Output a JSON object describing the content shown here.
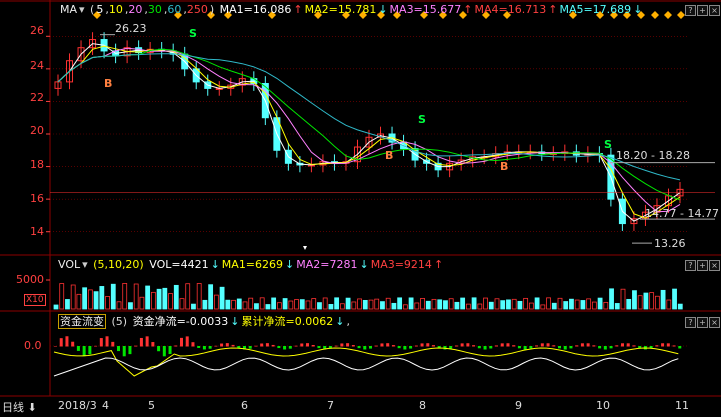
{
  "main_legend": {
    "indicator": "MA",
    "params_open": "(",
    "params": [
      "5",
      "10",
      "20",
      "30",
      "60",
      "250"
    ],
    "params_close": ")",
    "ma1": "MA1=16.086",
    "ma2": "MA2=15.781",
    "ma3": "MA3=15.677",
    "ma4": "MA4=16.713",
    "ma5": "MA5=17.689"
  },
  "vol_legend": {
    "indicator": "VOL",
    "params": "(5,10,20)",
    "vol": "VOL=4421",
    "ma1": "MA1=6269",
    "ma2": "MA2=7281",
    "ma3": "MA3=9214"
  },
  "flow_legend": {
    "indicator": "资金流变",
    "param": "(5)",
    "net": "资金净流=-0.0033",
    "cumulative": "累计净流=0.0062",
    "tail": ","
  },
  "price_axis": [
    "26",
    "24",
    "22",
    "20",
    "18",
    "16",
    "14"
  ],
  "vol_axis": [
    "5000",
    "X10"
  ],
  "flow_axis": [
    "0.0"
  ],
  "annotations": {
    "high": "26.23",
    "low": "13.26",
    "range1": "18.20 - 18.28",
    "range2": "14.77 - 14.77"
  },
  "signals": {
    "buy": "B",
    "sell": "S"
  },
  "footer": {
    "period": "日线",
    "dates": [
      "2018/3",
      "4",
      "5",
      "6",
      "7",
      "8",
      "9",
      "10",
      "11"
    ]
  },
  "colors": {
    "up": "#ff3232",
    "down": "#54ffff",
    "ma1": "#ffffff",
    "ma2": "#ffff00",
    "ma3": "#ff80ff",
    "ma4": "#00e600",
    "ma5": "#2fb8c8",
    "grid": "#8b0000",
    "marker": "#ffb000",
    "buy": "#ff8040",
    "sell": "#00ff40"
  },
  "chart_data": {
    "type": "candlestick",
    "ylim": [
      13,
      27
    ],
    "price_ticks": [
      26,
      24,
      22,
      20,
      18,
      16,
      14
    ],
    "months": [
      "2018/3",
      "4",
      "5",
      "6",
      "7",
      "8",
      "9",
      "10",
      "11"
    ],
    "close": [
      23.2,
      24.5,
      25.3,
      25.8,
      25.1,
      24.8,
      25.3,
      25.0,
      25.2,
      25.1,
      24.9,
      24.0,
      23.2,
      22.8,
      22.8,
      23.0,
      23.4,
      23.1,
      21.0,
      19.0,
      18.2,
      18.1,
      18.1,
      18.3,
      18.2,
      18.3,
      19.2,
      19.8,
      20.0,
      19.5,
      19.1,
      18.4,
      18.2,
      17.8,
      18.2,
      18.4,
      18.6,
      18.6,
      18.8,
      18.9,
      18.9,
      18.9,
      18.8,
      18.8,
      18.9,
      18.7,
      18.8,
      18.7,
      16.0,
      14.5,
      14.8,
      15.2,
      15.6,
      16.2,
      16.6
    ]
  }
}
